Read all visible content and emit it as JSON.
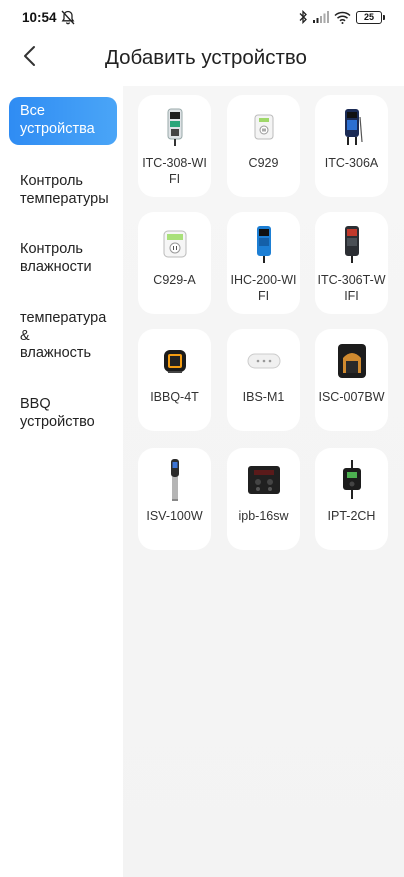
{
  "status": {
    "time": "10:54",
    "battery": "25"
  },
  "header": {
    "title": "Добавить устройство"
  },
  "sidebar": {
    "items": [
      {
        "label": "Все устройства"
      },
      {
        "label": "Контроль температуры"
      },
      {
        "label": "Контроль влажности"
      },
      {
        "label": "температура & влажность"
      },
      {
        "label": "BBQ устройство"
      }
    ]
  },
  "devices": [
    {
      "name": "ITC-308-WIFI",
      "icon": "thermostat-controller-icon"
    },
    {
      "name": "C929",
      "icon": "smart-plug-icon"
    },
    {
      "name": "ITC-306A",
      "icon": "dual-probe-controller-icon"
    },
    {
      "name": "C929-A",
      "icon": "plug-display-icon"
    },
    {
      "name": "IHC-200-WIFI",
      "icon": "humidity-controller-icon"
    },
    {
      "name": "ITC-306T-WIFI",
      "icon": "timer-controller-icon"
    },
    {
      "name": "IBBQ-4T",
      "icon": "bbq-thermometer-icon"
    },
    {
      "name": "IBS-M1",
      "icon": "gateway-icon"
    },
    {
      "name": "ISC-007BW",
      "icon": "smart-camera-icon"
    },
    {
      "name": "ISV-100W",
      "icon": "sous-vide-icon"
    },
    {
      "name": "ipb-16sw",
      "icon": "power-strip-icon"
    },
    {
      "name": "IPT-2CH",
      "icon": "plug-timer-icon"
    }
  ],
  "colors": {
    "accent": "#3194f4",
    "background": "#f4f4f4"
  }
}
